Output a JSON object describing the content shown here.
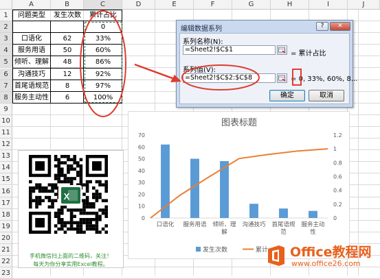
{
  "sheet": {
    "columns": [
      "A",
      "B",
      "C",
      "D",
      "E",
      "F",
      "G",
      "H",
      "I",
      "J"
    ],
    "rows": [
      "1",
      "2",
      "3",
      "4",
      "5",
      "6",
      "7",
      "8",
      "9",
      "10",
      "11",
      "12",
      "13",
      "14",
      "15",
      "16",
      "17",
      "18",
      "19",
      "20",
      "21",
      "22",
      "23"
    ],
    "selected_column": "C",
    "selected_rows": [
      "2",
      "3",
      "4",
      "5",
      "6",
      "7",
      "8"
    ],
    "headers": {
      "a1": "问题类型",
      "b1": "发生次数",
      "c1": "累计占比"
    },
    "data_rows": [
      {
        "type": "",
        "count": "",
        "pct": "0"
      },
      {
        "type": "口语化",
        "count": "62",
        "pct": "33%"
      },
      {
        "type": "服务用语",
        "count": "50",
        "pct": "60%"
      },
      {
        "type": "倾听、理解",
        "count": "48",
        "pct": "86%"
      },
      {
        "type": "沟通技巧",
        "count": "12",
        "pct": "92%"
      },
      {
        "type": "首尾语规范",
        "count": "8",
        "pct": "97%"
      },
      {
        "type": "服务主动性",
        "count": "6",
        "pct": "100%"
      }
    ]
  },
  "dialog": {
    "title": "编辑数据系列",
    "help": "?",
    "close": "✕",
    "name_label": "系列名称(N):",
    "name_value": "=Sheet2!$C$1",
    "name_result": "= 累计占比",
    "values_label": "系列值(V):",
    "values_value": "=Sheet2!$C$2:$C$8",
    "values_result_prefix": "= ",
    "values_result_highlight": "0",
    "values_result_rest": ", 33%, 60%, 8...",
    "ok": "确定",
    "cancel": "取消"
  },
  "chart": {
    "title": "图表标题",
    "legend_count": "发生次数",
    "legend_pct": "累计",
    "colors": {
      "bar": "#5b9bd5",
      "line": "#ed7d31",
      "annot": "#e03b2f"
    }
  },
  "chart_data": {
    "type": "bar",
    "categories": [
      "口语化",
      "服务用语",
      "倾听、理解",
      "沟通技巧",
      "首尾语规范",
      "服务主动性"
    ],
    "category_lines": [
      [
        "口语化"
      ],
      [
        "服务用语"
      ],
      [
        "倾听、理",
        "解"
      ],
      [
        "沟通技巧"
      ],
      [
        "首尾语规",
        "范"
      ],
      [
        "服务主动",
        "性"
      ]
    ],
    "series": [
      {
        "name": "发生次数",
        "type": "bar",
        "axis": "left",
        "values": [
          62,
          50,
          48,
          12,
          8,
          6
        ]
      },
      {
        "name": "累计",
        "type": "line",
        "axis": "right",
        "x": [
          0,
          1,
          2,
          3,
          4,
          5,
          6
        ],
        "values": [
          0,
          0.33,
          0.6,
          0.86,
          0.92,
          0.97,
          1.0
        ]
      }
    ],
    "y_left": {
      "ylim": [
        0,
        70
      ],
      "ticks": [
        "0",
        "10",
        "20",
        "30",
        "40",
        "50",
        "60",
        "70"
      ]
    },
    "y_right": {
      "ylim": [
        0,
        1.2
      ],
      "ticks": [
        "0",
        "0.2",
        "0.4",
        "0.6",
        "0.8",
        "1",
        "1.2"
      ]
    },
    "grid": false,
    "legend": "bottom"
  },
  "qr": {
    "caption_line1": "手机微信扫上面的二维码，关注！",
    "caption_line2": "每天为你分享实用Excel教程。",
    "icon": "excel-logo-icon"
  },
  "watermark": {
    "brand": "Office教程网",
    "url": "www.office26.com",
    "icon": "office-logo-icon"
  }
}
